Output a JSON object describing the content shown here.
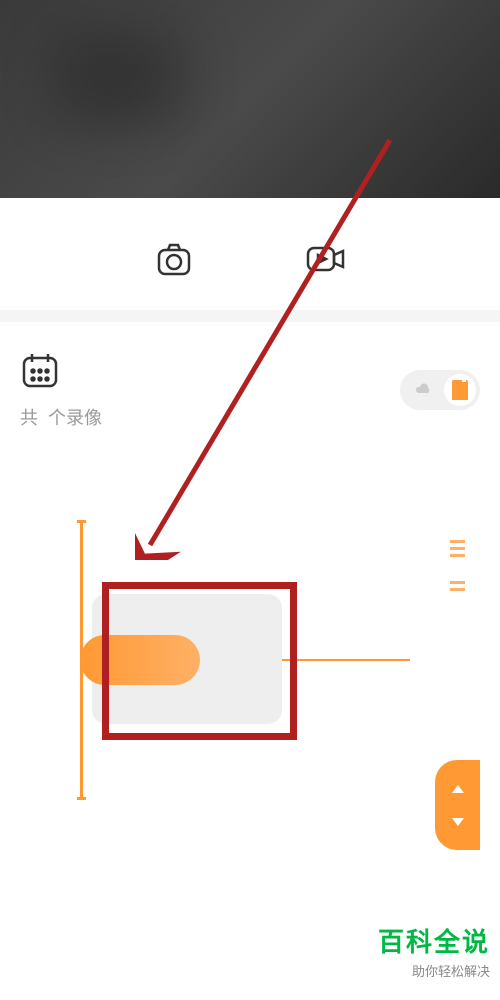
{
  "recording": {
    "count_prefix": "共",
    "count_suffix": "个录像"
  },
  "watermark": {
    "title": "百科全说",
    "subtitle": "助你轻松解决"
  }
}
